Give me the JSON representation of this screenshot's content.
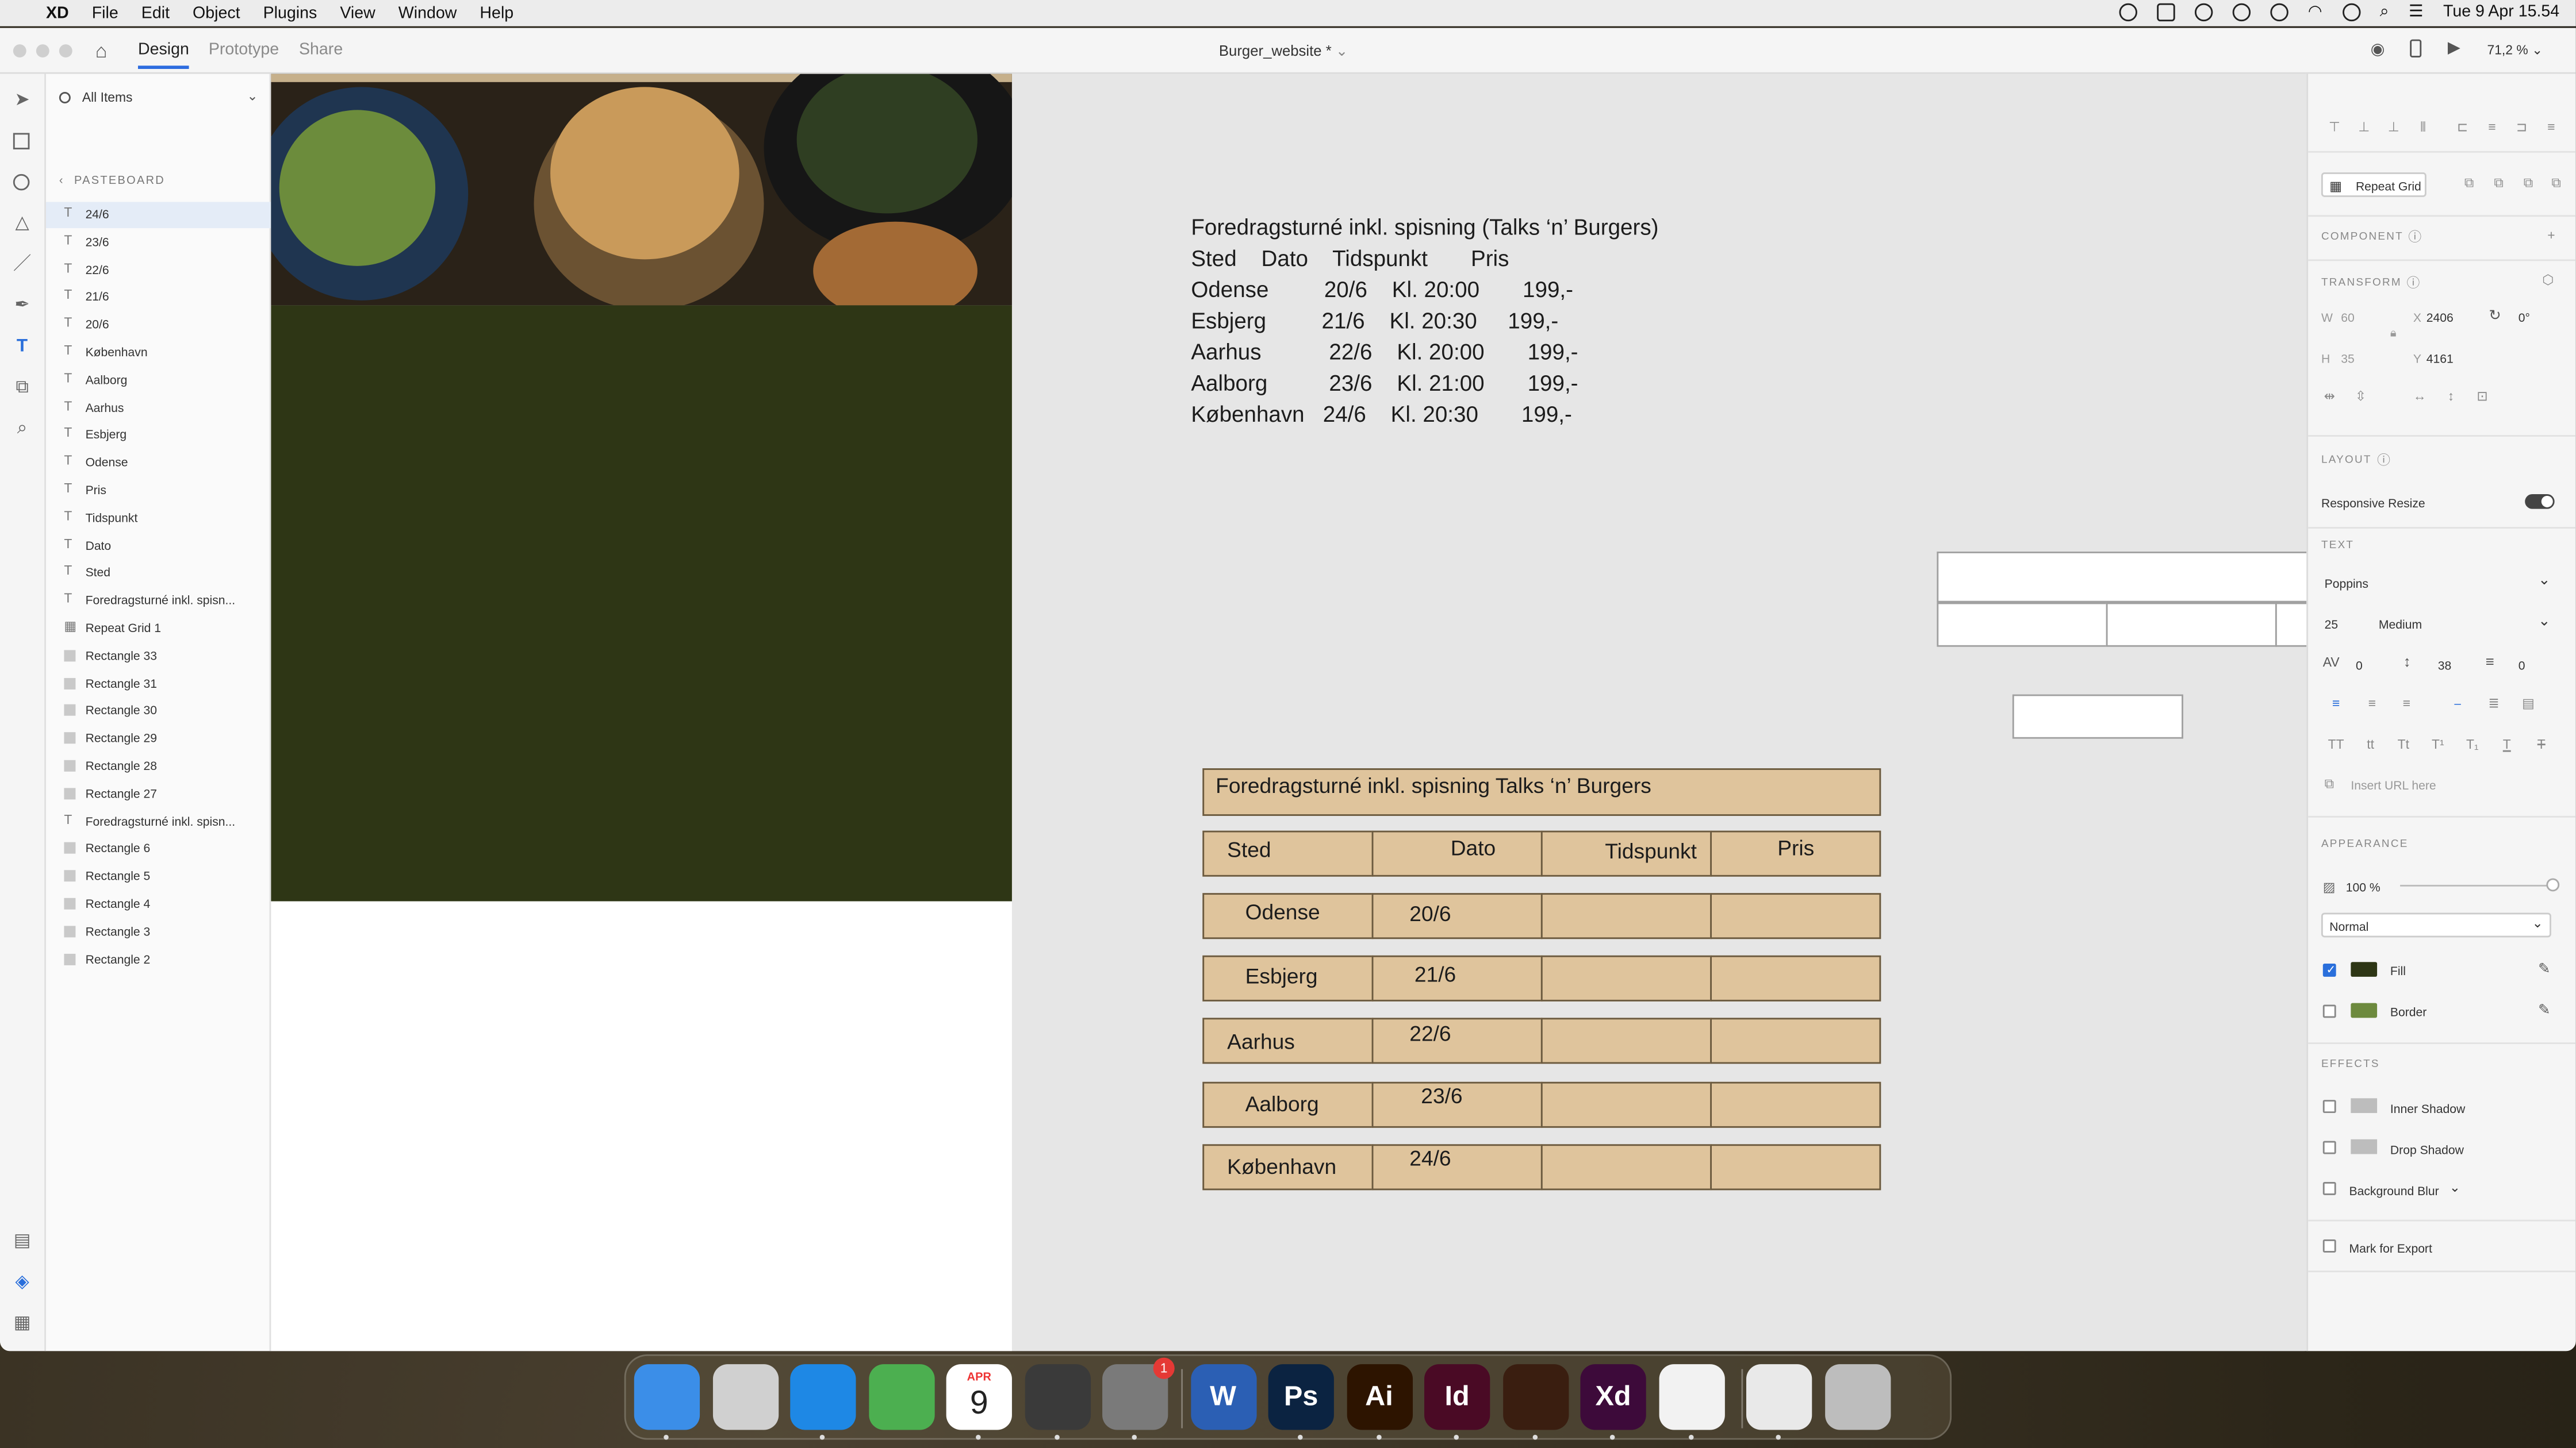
{
  "menubar": {
    "app": "XD",
    "items": [
      "File",
      "Edit",
      "Object",
      "Plugins",
      "View",
      "Window",
      "Help"
    ],
    "clock": "Tue 9 Apr  15.54"
  },
  "titlebar": {
    "tabs": [
      "Design",
      "Prototype",
      "Share"
    ],
    "document": "Burger_website *",
    "zoom": "71,2 %"
  },
  "layers": {
    "search_placeholder": "All Items",
    "pasteboard": "PASTEBOARD",
    "items": [
      {
        "type": "text",
        "name": "24/6"
      },
      {
        "type": "text",
        "name": "23/6"
      },
      {
        "type": "text",
        "name": "22/6"
      },
      {
        "type": "text",
        "name": "21/6"
      },
      {
        "type": "text",
        "name": "20/6"
      },
      {
        "type": "text",
        "name": "København"
      },
      {
        "type": "text",
        "name": "Aalborg"
      },
      {
        "type": "text",
        "name": "Aarhus"
      },
      {
        "type": "text",
        "name": "Esbjerg"
      },
      {
        "type": "text",
        "name": "Odense"
      },
      {
        "type": "text",
        "name": "Pris"
      },
      {
        "type": "text",
        "name": "Tidspunkt"
      },
      {
        "type": "text",
        "name": "Dato"
      },
      {
        "type": "text",
        "name": "Sted"
      },
      {
        "type": "text",
        "name": "Foredragsturné inkl. spisn..."
      },
      {
        "type": "grid",
        "name": "Repeat Grid 1"
      },
      {
        "type": "rect",
        "name": "Rectangle 33"
      },
      {
        "type": "rect",
        "name": "Rectangle 31"
      },
      {
        "type": "rect",
        "name": "Rectangle 30"
      },
      {
        "type": "rect",
        "name": "Rectangle 29"
      },
      {
        "type": "rect",
        "name": "Rectangle 28"
      },
      {
        "type": "rect",
        "name": "Rectangle 27"
      },
      {
        "type": "text",
        "name": "Foredragsturné inkl. spisn..."
      },
      {
        "type": "rect",
        "name": "Rectangle 6"
      },
      {
        "type": "rect",
        "name": "Rectangle 5"
      },
      {
        "type": "rect",
        "name": "Rectangle 4"
      },
      {
        "type": "rect",
        "name": "Rectangle 3"
      },
      {
        "type": "rect",
        "name": "Rectangle 2"
      }
    ]
  },
  "canvas": {
    "info": {
      "title": "Foredragsturné inkl. spisning (Talks ‘n’ Burgers)",
      "header": "Sted    Dato    Tidspunkt       Pris",
      "rows": [
        "Odense         20/6    Kl. 20:00       199,-",
        "Esbjerg         21/6    Kl. 20:30     199,-",
        "Aarhus           22/6    Kl. 20:00       199,-",
        "Aalborg          23/6    Kl. 21:00       199,-",
        "København   24/6    Kl. 20:30       199,-"
      ]
    },
    "table": {
      "title": "Foredragsturné inkl. spisning Talks ‘n’ Burgers",
      "headers": [
        "Sted",
        "Dato",
        "Tidspunkt",
        "Pris"
      ],
      "rows": [
        {
          "city": "Odense",
          "date": "20/6"
        },
        {
          "city": "Esbjerg",
          "date": "21/6"
        },
        {
          "city": "Aarhus",
          "date": "22/6"
        },
        {
          "city": "Aalborg",
          "date": "23/6"
        },
        {
          "city": "København",
          "date": "24/6"
        }
      ]
    }
  },
  "props": {
    "repeat_grid": "Repeat Grid",
    "component": "COMPONENT",
    "transform": "TRANSFORM",
    "w_label": "W",
    "w": "60",
    "h_label": "H",
    "h": "35",
    "x_label": "X",
    "x": "2406",
    "y_label": "Y",
    "y": "4161",
    "rotation": "0°",
    "layout": "LAYOUT",
    "responsive": "Responsive Resize",
    "text": "TEXT",
    "font": "Poppins",
    "font_size": "25",
    "weight": "Medium",
    "char_spacing": "0",
    "line_spacing": "38",
    "para_spacing": "0",
    "url_placeholder": "Insert URL here",
    "appearance": "APPEARANCE",
    "opacity": "100 %",
    "blend": "Normal",
    "fill": "Fill",
    "fill_color": "#2e3615",
    "border": "Border",
    "border_color": "#6d8a3e",
    "effects": "EFFECTS",
    "inner_shadow": "Inner Shadow",
    "drop_shadow": "Drop Shadow",
    "bg_blur": "Background Blur",
    "export": "Mark for Export"
  },
  "dock": {
    "apps": [
      {
        "name": "Finder",
        "label": "",
        "color": "#3b8ee8"
      },
      {
        "name": "Launchpad",
        "label": "",
        "color": "#d0d0d0"
      },
      {
        "name": "Safari",
        "label": "",
        "color": "#1e88e5"
      },
      {
        "name": "Maps",
        "label": "",
        "color": "#4caf50"
      },
      {
        "name": "Calendar",
        "label": "9",
        "month": "APR",
        "color": "#ffffff"
      },
      {
        "name": "Calculator",
        "label": "",
        "color": "#3a3a3a"
      },
      {
        "name": "System Settings",
        "label": "",
        "badge": "1",
        "color": "#7a7a7a"
      },
      {
        "name": "Word",
        "label": "W",
        "color": "#2b5fb4"
      },
      {
        "name": "Photoshop",
        "label": "Ps",
        "color": "#0b2341"
      },
      {
        "name": "Illustrator",
        "label": "Ai",
        "color": "#2d1400"
      },
      {
        "name": "InDesign",
        "label": "Id",
        "color": "#4a0a25"
      },
      {
        "name": "OmniFocus",
        "label": "",
        "color": "#3a1e10"
      },
      {
        "name": "Adobe XD",
        "label": "Xd",
        "color": "#3d0a3a"
      },
      {
        "name": "TextEdit",
        "label": "",
        "color": "#f2f2f2"
      },
      {
        "name": "XD File",
        "label": "",
        "color": "#e9e9e9"
      },
      {
        "name": "Trash",
        "label": "",
        "color": "#bdbdbd"
      }
    ]
  }
}
